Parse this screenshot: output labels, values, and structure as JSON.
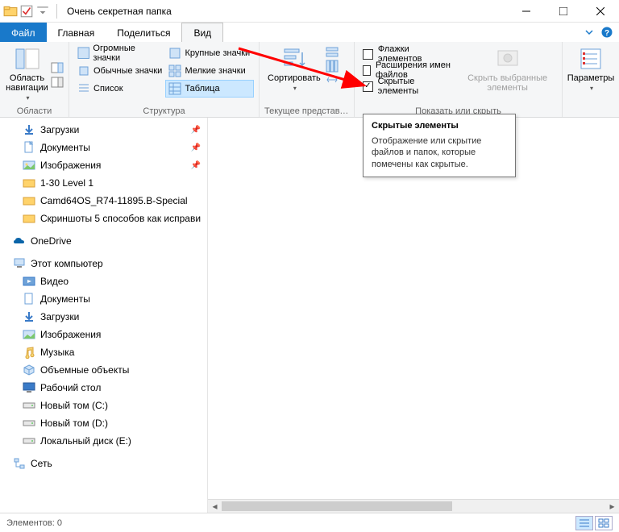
{
  "window": {
    "title": "Очень секретная папка"
  },
  "tabs": {
    "file": "Файл",
    "home": "Главная",
    "share": "Поделиться",
    "view": "Вид"
  },
  "ribbon": {
    "panes": {
      "nav_pane": "Область навигации",
      "label": "Области"
    },
    "layout": {
      "huge": "Огромные значки",
      "large": "Крупные значки",
      "medium": "Обычные значки",
      "small": "Мелкие значки",
      "list": "Список",
      "table": "Таблица",
      "label": "Структура"
    },
    "view": {
      "sort": "Сортировать",
      "label": "Текущее представлен..."
    },
    "show": {
      "item_checkboxes": "Флажки элементов",
      "extensions": "Расширения имен файлов",
      "hidden": "Скрытые элементы",
      "hide_selected": "Скрыть выбранные элементы",
      "label": "Показать или скрыть"
    },
    "options": {
      "btn": "Параметры"
    }
  },
  "nav": {
    "downloads": "Загрузки",
    "documents": "Документы",
    "pictures": "Изображения",
    "level": "1-30 Level 1",
    "camd": "Camd64OS_R74-11895.B-Special",
    "screenshots": "Скриншоты 5 способов как исправи",
    "onedrive": "OneDrive",
    "thispc": "Этот компьютер",
    "videos": "Видео",
    "documents2": "Документы",
    "downloads2": "Загрузки",
    "pictures2": "Изображения",
    "music": "Музыка",
    "objects3d": "Объемные объекты",
    "desktop": "Рабочий стол",
    "volc": "Новый том (C:)",
    "vold": "Новый том (D:)",
    "vole": "Локальный диск (E:)",
    "network": "Сеть"
  },
  "status": {
    "items": "Элементов: 0"
  },
  "tooltip": {
    "title": "Скрытые элементы",
    "body": "Отображение или скрытие файлов и папок, которые помечены как скрытые."
  }
}
